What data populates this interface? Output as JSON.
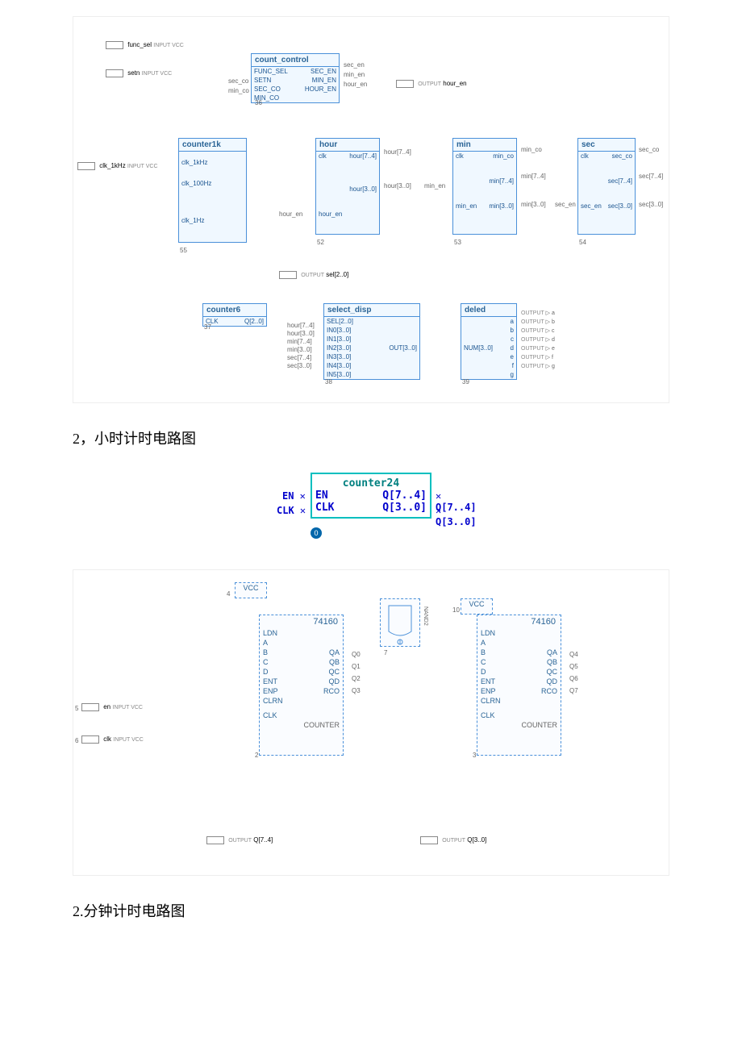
{
  "top_diagram": {
    "inputs": {
      "func_sel": "func_sel",
      "setn": "setn",
      "clk_1khz": "clk_1kHz"
    },
    "count_control": {
      "title": "count_control",
      "ports_left": [
        "FUNC_SEL",
        "SETN",
        "SEC_CO",
        "MIN_CO"
      ],
      "ports_right": [
        "SEC_EN",
        "MIN_EN",
        "HOUR_EN"
      ],
      "id": "36"
    },
    "counter1k": {
      "title": "counter1k",
      "ports": [
        "clk_1kHz",
        "clk_100Hz",
        "clk_1Hz"
      ],
      "id": "55"
    },
    "hour": {
      "title": "hour",
      "ports_left": [
        "clk",
        "hour_en"
      ],
      "ports_right": [
        "hour[7..4]",
        "hour[3..0]"
      ],
      "id": "52"
    },
    "min": {
      "title": "min",
      "ports_left": [
        "clk",
        "min_en"
      ],
      "ports_right": [
        "min_co",
        "min[7..4]",
        "min[3..0]"
      ],
      "id": "53"
    },
    "sec": {
      "title": "sec",
      "ports_left": [
        "clk",
        "sec_en"
      ],
      "ports_right": [
        "sec_co",
        "sec[7..4]",
        "sec[3..0]"
      ],
      "id": "54"
    },
    "counter6": {
      "title": "counter6",
      "ports": [
        "CLK",
        "Q[2..0]"
      ],
      "id": "37"
    },
    "select_disp": {
      "title": "select_disp",
      "ports_left": [
        "SEL[2..0]",
        "IN0[3..0]",
        "IN1[3..0]",
        "IN2[3..0]",
        "IN3[3..0]",
        "IN4[3..0]",
        "IN5[3..0]"
      ],
      "ports_right": [
        "OUT[3..0]"
      ],
      "inputs": [
        "hour[7..4]",
        "hour[3..0]",
        "min[7..4]",
        "min[3..0]",
        "sec[7..4]",
        "sec[3..0]"
      ],
      "id": "38"
    },
    "deled": {
      "title": "deled",
      "port_left": "NUM[3..0]",
      "ports_right": [
        "a",
        "b",
        "c",
        "d",
        "e",
        "f",
        "g"
      ],
      "id": "39"
    },
    "wires": {
      "sec_en": "sec_en",
      "min_en": "min_en",
      "hour_en": "hour_en",
      "sec_co": "sec_co",
      "min_co": "min_co",
      "hour74": "hour[7..4]",
      "hour30": "hour[3..0]",
      "min_co_w": "min_co",
      "min74": "min[7..4]",
      "min30": "min[3..0]",
      "sec_co_w": "sec_co",
      "sec74": "sec[7..4]",
      "sec30": "sec[3..0]",
      "sel": "sel[2..0]"
    },
    "outputs": {
      "hour_en": "hour_en",
      "sel20": "sel[2..0]"
    }
  },
  "heading1": "2，小时计时电路图",
  "counter24": {
    "title": "counter24",
    "left": [
      "EN",
      "CLK"
    ],
    "right": [
      "Q[7..4]",
      "Q[3..0]"
    ],
    "id": "0"
  },
  "heading2": "2.分钟计时电路图",
  "circuit": {
    "vcc": "VCC",
    "chip": "74160",
    "nand": "NAND2",
    "pins_left": [
      "LDN",
      "A",
      "B",
      "C",
      "D",
      "ENT",
      "ENP",
      "CLRN",
      "CLK"
    ],
    "pins_right": [
      "QA",
      "QB",
      "QC",
      "QD",
      "RCO"
    ],
    "outputs_left": [
      "Q0",
      "Q1",
      "Q2",
      "Q3"
    ],
    "outputs_right": [
      "Q4",
      "Q5",
      "Q6",
      "Q7"
    ],
    "label": "COUNTER",
    "inputs": {
      "en": "en",
      "clk": "clk"
    },
    "out_pins": {
      "q74": "Q[7..4]",
      "q30": "Q[3..0]"
    },
    "ids": {
      "vcc1": "4",
      "vcc2": "10",
      "en": "5",
      "clk": "6",
      "chip1": "2",
      "chip2": "3",
      "nand": "7"
    }
  }
}
